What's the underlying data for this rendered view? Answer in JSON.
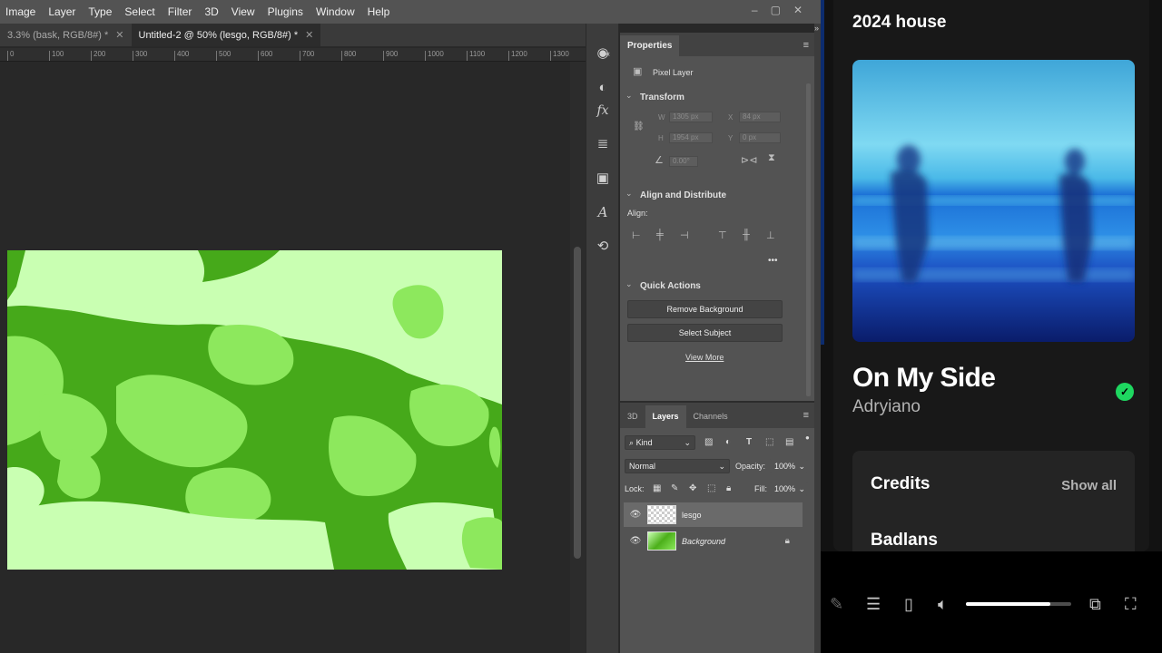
{
  "photoshop": {
    "menus": [
      "Image",
      "Layer",
      "Type",
      "Select",
      "Filter",
      "3D",
      "View",
      "Plugins",
      "Window",
      "Help"
    ],
    "window_controls": [
      "–",
      "▢",
      "✕"
    ],
    "doc_tabs": [
      {
        "label": "3.3% (bask, RGB/8#) *",
        "active": false
      },
      {
        "label": "Untitled-2 @ 50% (lesgo, RGB/8#) *",
        "active": true
      }
    ],
    "ruler_ticks": [
      "0",
      "100",
      "200",
      "300",
      "400",
      "500",
      "600",
      "700",
      "800",
      "900",
      "1000",
      "1100",
      "1200",
      "1300"
    ],
    "properties": {
      "tab": "Properties",
      "layer_type": "Pixel Layer",
      "transform_title": "Transform",
      "w_label": "W",
      "w_value": "1305 px",
      "h_label": "H",
      "h_value": "1954 px",
      "x_label": "X",
      "x_value": "84 px",
      "y_label": "Y",
      "y_value": "0 px",
      "angle_value": "0.00°",
      "align_title": "Align and Distribute",
      "align_label": "Align:",
      "more": "•••",
      "quick_title": "Quick Actions",
      "remove_bg": "Remove Background",
      "select_subject": "Select Subject",
      "view_more": "View More"
    },
    "layers_panel": {
      "tabs": [
        "3D",
        "Layers",
        "Channels"
      ],
      "active_tab": "Layers",
      "kind": "Kind",
      "blend_mode": "Normal",
      "opacity_label": "Opacity:",
      "opacity_value": "100%",
      "lock_label": "Lock:",
      "fill_label": "Fill:",
      "fill_value": "100%",
      "layers": [
        {
          "name": "lesgo",
          "selected": true,
          "locked": false,
          "italic": false,
          "thumb": "transparent"
        },
        {
          "name": "Background",
          "selected": false,
          "locked": true,
          "italic": true,
          "thumb": "green"
        }
      ]
    }
  },
  "spotify": {
    "playlist_title": "2024 house",
    "song_title": "On My Side",
    "artist": "Adryiano",
    "liked": true,
    "credits_title": "Credits",
    "show_all": "Show all",
    "credit_name": "Badlans",
    "volume": 0.8,
    "accent_color": "#1ed760"
  }
}
